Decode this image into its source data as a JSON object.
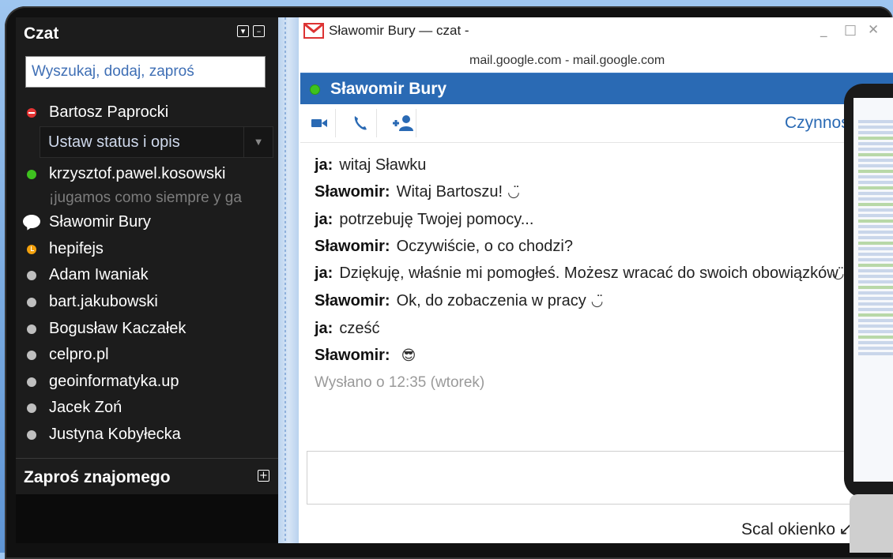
{
  "sidebar": {
    "title": "Czat",
    "minimize_icon": "minimize-icon",
    "search_placeholder": "Wyszukaj, dodaj, zaproś",
    "me": {
      "name": "Bartosz Paprocki",
      "status": "busy"
    },
    "status_select": "Ustaw status i opis",
    "contacts": [
      {
        "name": "krzysztof.pawel.kosowski",
        "status": "available",
        "note": "¡jugamos como siempre y ga"
      },
      {
        "name": "Sławomir Bury",
        "status": "chatting"
      },
      {
        "name": "hepifejs",
        "status": "idle"
      },
      {
        "name": "Adam Iwaniak",
        "status": "offline"
      },
      {
        "name": "bart.jakubowski",
        "status": "offline"
      },
      {
        "name": "Bogusław Kaczałek",
        "status": "offline"
      },
      {
        "name": "celpro.pl",
        "status": "offline"
      },
      {
        "name": "geoinformatyka.up",
        "status": "offline"
      },
      {
        "name": "Jacek Zoń",
        "status": "offline"
      },
      {
        "name": "Justyna Kobyłecka",
        "status": "offline"
      }
    ],
    "invite_label": "Zaproś znajomego"
  },
  "popup": {
    "window_title": "Sławomir Bury — czat -",
    "url": "mail.google.com - mail.google.com",
    "contact_name": "Sławomir Bury",
    "actions_label": "Czynności",
    "messages": [
      {
        "who": "ja:",
        "text": "witaj Sławku",
        "emoji": ""
      },
      {
        "who": "Sławomir:",
        "text": "Witaj Bartoszu!",
        "emoji": "◡̈"
      },
      {
        "who": "ja:",
        "text": "potrzebuję Twojej pomocy...",
        "emoji": ""
      },
      {
        "who": "Sławomir:",
        "text": "Oczywiście, o co chodzi?",
        "emoji": ""
      },
      {
        "who": "ja:",
        "text": "Dziękuję, właśnie mi pomogłeś. Możesz wracać do swoich obowiązków",
        "emoji": "◡̈"
      },
      {
        "who": "Sławomir:",
        "text": "Ok, do zobaczenia w pracy",
        "emoji": "◡̈"
      },
      {
        "who": "ja:",
        "text": "cześć",
        "emoji": ""
      },
      {
        "who": "Sławomir:",
        "text": "",
        "emoji": "😎"
      }
    ],
    "sent_info": "Wysłano o 12:35 (wtorek)",
    "merge_label": "Scal okienko",
    "colors": {
      "header": "#2a6ab4",
      "link": "#2a6ab4",
      "online": "#3ec21f"
    }
  }
}
